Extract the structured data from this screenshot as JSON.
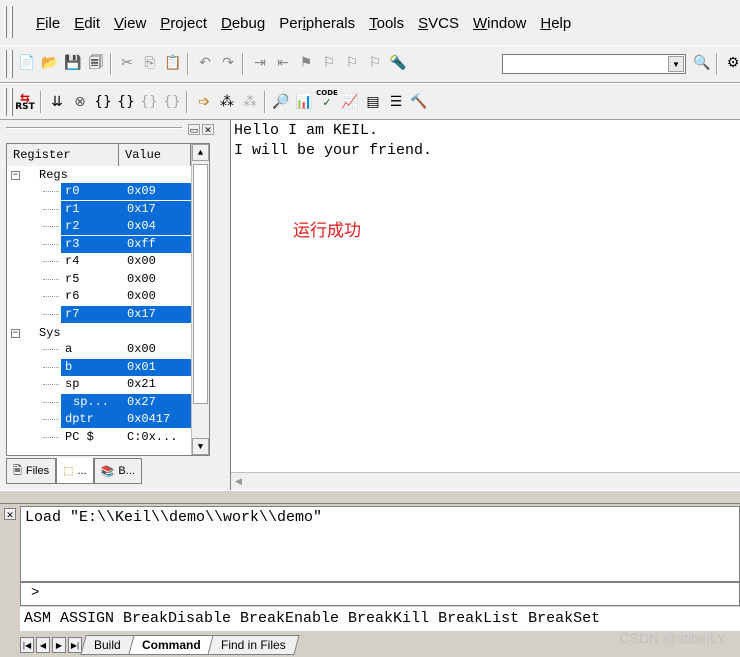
{
  "menubar": {
    "items": [
      {
        "key": "F",
        "rest": "ile"
      },
      {
        "key": "E",
        "rest": "dit"
      },
      {
        "key": "V",
        "rest": "iew"
      },
      {
        "key": "P",
        "rest": "roject"
      },
      {
        "key": "D",
        "rest": "ebug"
      },
      {
        "pre": "Per",
        "key": "i",
        "rest": "pherals"
      },
      {
        "key": "T",
        "rest": "ools"
      },
      {
        "key": "S",
        "rest": "VCS"
      },
      {
        "key": "W",
        "rest": "indow"
      },
      {
        "key": "H",
        "rest": "elp"
      }
    ]
  },
  "toolbar": {
    "rst_label": "RST",
    "code_label": "CODE"
  },
  "registers": {
    "col_register": "Register",
    "col_value": "Value",
    "group_regs": "Regs",
    "group_sys": "Sys",
    "regs": [
      {
        "name": "r0",
        "value": "0x09"
      },
      {
        "name": "r1",
        "value": "0x17"
      },
      {
        "name": "r2",
        "value": "0x04"
      },
      {
        "name": "r3",
        "value": "0xff"
      },
      {
        "name": "r4",
        "value": "0x00"
      },
      {
        "name": "r5",
        "value": "0x00"
      },
      {
        "name": "r6",
        "value": "0x00"
      },
      {
        "name": "r7",
        "value": "0x17"
      }
    ],
    "sys": [
      {
        "name": "a",
        "value": "0x00"
      },
      {
        "name": "b",
        "value": "0x01"
      },
      {
        "name": "sp",
        "value": "0x21"
      },
      {
        "name": "sp...",
        "value": "0x27"
      },
      {
        "name": "dptr",
        "value": "0x0417"
      },
      {
        "name": "PC  $",
        "value": "C:0x..."
      }
    ]
  },
  "lefttabs": {
    "files": "Files",
    "regs": "...",
    "books": "B..."
  },
  "editor": {
    "line1": "Hello I am KEIL.",
    "line2": "I will be your friend.",
    "annotation": "运行成功"
  },
  "command": {
    "output": "Load \"E:\\\\Keil\\\\demo\\\\work\\\\demo\"",
    "prompt": ">",
    "hint": "ASM ASSIGN BreakDisable BreakEnable BreakKill BreakList BreakSet",
    "tabs": [
      "Build",
      "Command",
      "Find in Files"
    ]
  },
  "watermark": "CSDN @stibeiLY",
  "colors": {
    "selection": "#0a6cd6",
    "annotation": "#e02020"
  }
}
